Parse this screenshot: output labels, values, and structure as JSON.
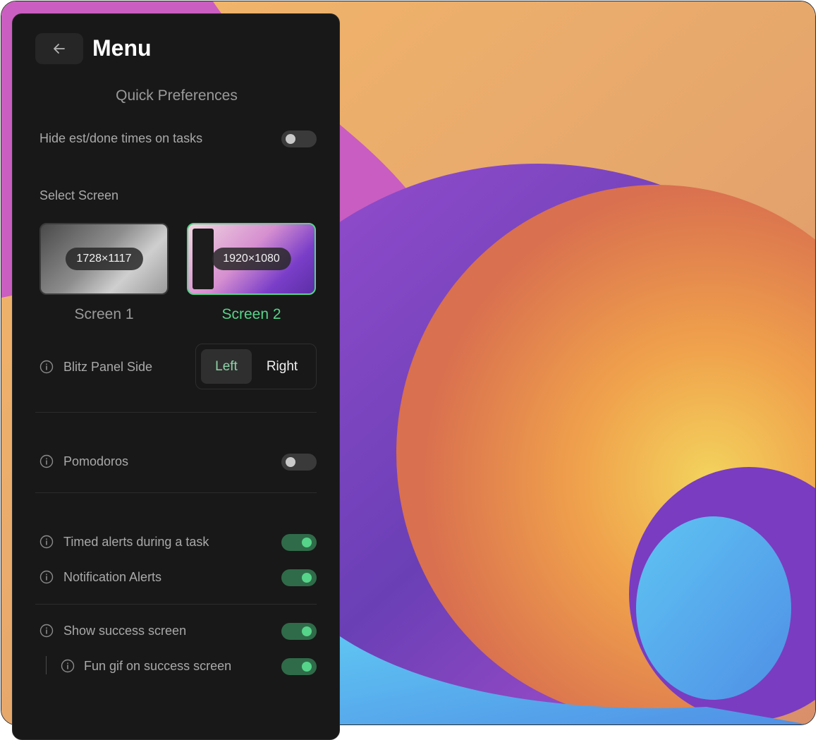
{
  "menu": {
    "title": "Menu",
    "back_icon": "arrow-left-icon"
  },
  "quick_prefs": {
    "title": "Quick Preferences"
  },
  "hide_times": {
    "label": "Hide est/done times on tasks",
    "enabled": false
  },
  "select_screen": {
    "label": "Select Screen",
    "screens": [
      {
        "name": "Screen 1",
        "resolution": "1728×1117",
        "selected": false
      },
      {
        "name": "Screen 2",
        "resolution": "1920×1080",
        "selected": true
      }
    ]
  },
  "panel_side": {
    "label": "Blitz Panel Side",
    "options": [
      "Left",
      "Right"
    ],
    "selected": "Left"
  },
  "pomodoros": {
    "label": "Pomodoros",
    "enabled": false
  },
  "timed_alerts": {
    "label": "Timed alerts during a task",
    "enabled": true
  },
  "notification_alerts": {
    "label": "Notification Alerts",
    "enabled": true
  },
  "success_screen": {
    "label": "Show success screen",
    "enabled": true
  },
  "fun_gif": {
    "label": "Fun gif on success screen",
    "enabled": true
  },
  "colors": {
    "accent_green": "#56d489",
    "panel_bg": "#181818"
  }
}
